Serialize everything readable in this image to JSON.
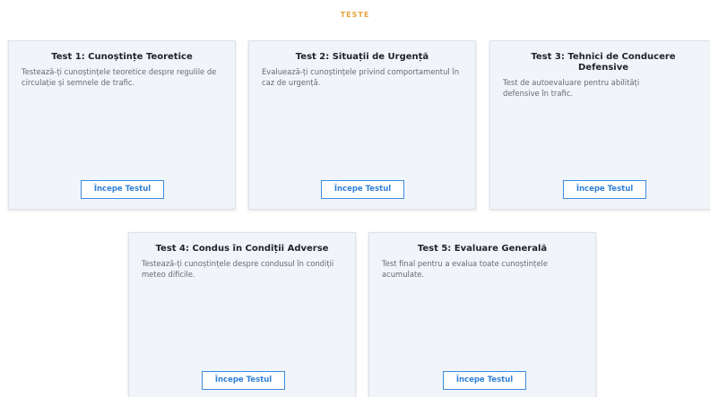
{
  "section": {
    "title": "TESTE"
  },
  "tests": [
    {
      "title": "Test 1: Cunoștințe Teoretice",
      "description": "Testează-ți cunoștințele teoretice despre regulile de circulație și semnele de trafic.",
      "button_label": "Începe Testul"
    },
    {
      "title": "Test 2: Situații de Urgență",
      "description": "Evaluează-ți cunoștințele privind comportamentul în caz de urgență.",
      "button_label": "Începe Testul"
    },
    {
      "title": "Test 3: Tehnici de Conducere Defensive",
      "description": "Test de autoevaluare pentru abilități defensive în trafic.",
      "button_label": "Începe Testul"
    },
    {
      "title": "Test 4: Condus în Condiții Adverse",
      "description": "Testează-ți cunoștințele despre condusul în condiții meteo dificile.",
      "button_label": "Începe Testul"
    },
    {
      "title": "Test 5: Evaluare Generală",
      "description": "Test final pentru a evalua toate cunoștințele acumulate.",
      "button_label": "Începe Testul"
    }
  ],
  "colors": {
    "accent": "#e8a33a",
    "button": "#2f7fd9",
    "card_background": "#f1f5f9"
  }
}
